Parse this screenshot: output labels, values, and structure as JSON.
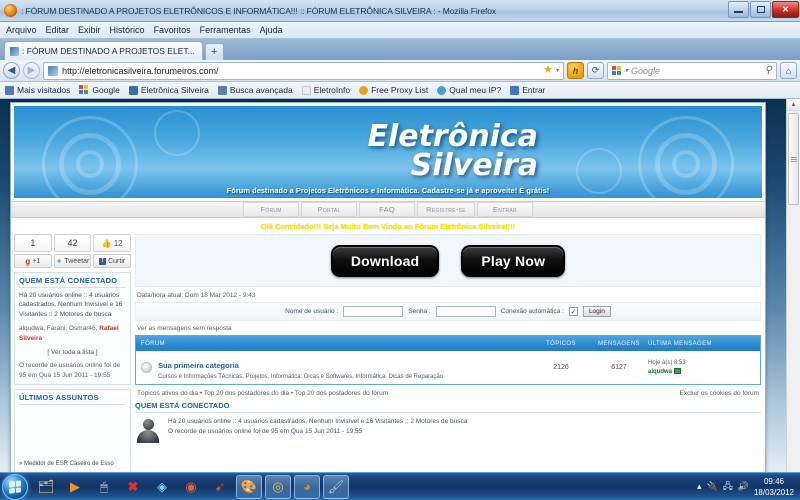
{
  "window": {
    "title": ": FÓRUM DESTINADO A PROJETOS ELETRÔNICOS E INFORMÁTICA!!! :: FÓRUM ELETRÔNICA SILVEIRA : - Mozilla Firefox",
    "app_icon": "firefox-icon",
    "minimize_label": "Minimizar",
    "maximize_label": "Restaurar",
    "close_label": "Fechar"
  },
  "menubar": {
    "items": [
      {
        "label": "Arquivo"
      },
      {
        "label": "Editar"
      },
      {
        "label": "Exibir"
      },
      {
        "label": "Histórico"
      },
      {
        "label": "Favoritos"
      },
      {
        "label": "Ferramentas"
      },
      {
        "label": "Ajuda"
      }
    ]
  },
  "tabs": {
    "items": [
      {
        "label": ": FÓRUM DESTINADO A PROJETOS ELET..."
      }
    ],
    "new_tab_label": "+"
  },
  "navbar": {
    "back_label": "◀",
    "forward_label": "▶",
    "url": "http://eletronicasilveira.forumeiros.com/",
    "star_label": "★",
    "caret_label": "▾",
    "addon_label": "h",
    "reload_label": "⟳",
    "home_label": "⌂",
    "search_placeholder": "Google",
    "search_value": "",
    "magnify_label": "⚲"
  },
  "bookmarks": {
    "items": [
      {
        "label": "Mais visitados",
        "color": "#4d79b5"
      },
      {
        "label": "Google",
        "color": "#3b77d8"
      },
      {
        "label": "Eletrônica Silveira",
        "color": "#3a6ea8"
      },
      {
        "label": "Busca avançada",
        "color": "#5a7fa8"
      },
      {
        "label": "EletroInfo",
        "color": "#e6e6e6"
      },
      {
        "label": "Free Proxy List",
        "color": "#e8a21c"
      },
      {
        "label": "Qual meu IP?",
        "color": "#4a9ed6"
      },
      {
        "label": "Entrar",
        "color": "#4472c4"
      }
    ]
  },
  "forum": {
    "banner": {
      "line1": "Eletrônica",
      "line2": "Silveira",
      "subtitle": "Fórum destinado a Projetos Eletrônicos e Informática. Cadastre-se já e aproveite! É grátis!"
    },
    "nav": [
      {
        "label": "Fórum"
      },
      {
        "label": "Portal"
      },
      {
        "label": "FAQ"
      },
      {
        "label": "Registre-se"
      },
      {
        "label": "Entrar"
      }
    ],
    "announcement": "Olá Convidado!!! Seja Muito Bem Vindo ao Fórum Eletrônica Silveira!!!!",
    "sidebar": {
      "social_counts": [
        {
          "value": "1"
        },
        {
          "value": "42"
        },
        {
          "value": "12",
          "icon": "thumbs-up-icon"
        }
      ],
      "social_buttons": [
        {
          "label": "+1",
          "icon": "google-plus-icon"
        },
        {
          "label": "Tweetar",
          "icon": "twitter-icon"
        },
        {
          "label": "Curtir",
          "icon": "facebook-icon"
        }
      ],
      "who_online": {
        "title": "QUEM ESTÁ CONECTADO",
        "summary": "Há 20 usuários online :: 4 usuários cadastrados, Nenhum Invisível e 16 Visitantes :: 2 Motores de busca",
        "count": "20",
        "users_plain": "alqudwa, Farani, Osmar46, ",
        "users_highlight": "Rafael Silveira",
        "list_link": "[ Ver toda a lista ]",
        "record": "O recorde de usuários online foi de 95 em Qua 15 Jun 2011 - 19:55",
        "record_value": "95"
      },
      "latest": {
        "title": "ÚLTIMOS ASSUNTOS",
        "items": [
          {
            "label": "» Medidor de ESR Caseiro de Esso"
          }
        ]
      }
    },
    "promo": {
      "download_label": "Download",
      "play_label": "Play Now"
    },
    "datetime": "Data/hora atual: Dom 18 Mar 2012 - 9:43",
    "login": {
      "username_label": "Nome de usuário :",
      "username_value": "",
      "password_label": "Senha :",
      "password_value": "",
      "autologin_label": "Conexão automática :",
      "autologin_checked": "✓",
      "submit_label": "Login"
    },
    "unanswered_link": "Ver as mensagens sem resposta",
    "table": {
      "headers": {
        "forum": "FÓRUM",
        "topics": "TÓPICOS",
        "messages": "MENSAGENS",
        "last_message": "ÚLTIMA MENSAGEM"
      },
      "rows": [
        {
          "name": "Sua primeira categoria",
          "description": "Cursos e Informações Técnicas, Projetos, Informática: Dicas e Softwares, Informática: Dicas de Reparação",
          "topics": "2126",
          "messages": "6127",
          "last_time": "Hoje à(s) 8:53",
          "last_author": "alqudwa"
        }
      ]
    },
    "footer_links": {
      "left": "Tópicos ativos do dia • Top 20 dos postadores do dia • Top 20 dos postadores do fórum",
      "right": "Excluir os cookies do fórum"
    },
    "who_online_main": {
      "title": "QUEM ESTÁ CONECTADO",
      "line1": "Há 20 usuários online :: 4 usuários cadastrados, Nenhum Invisível e 16 Visitantes :: 2 Motores de busca",
      "line1_count": "20",
      "line2": "O recorde de usuários online foi de 95 em Qua 15 Jun 2011 - 19:55",
      "line2_count": "95"
    }
  },
  "taskbar": {
    "start_label": "Iniciar",
    "apps": [
      {
        "name": "explorer-folder-icon",
        "glyph": "🗂",
        "active": false
      },
      {
        "name": "media-player-icon",
        "glyph": "▶",
        "active": false
      },
      {
        "name": "mouse-utility-icon",
        "glyph": "🖱",
        "active": false
      },
      {
        "name": "x-app-icon",
        "glyph": "✖",
        "active": false
      },
      {
        "name": "diamond-app-icon",
        "glyph": "◈",
        "active": false
      },
      {
        "name": "flame-app-icon",
        "glyph": "◉",
        "active": false
      },
      {
        "name": "rocket-app-icon",
        "glyph": "➹",
        "active": false
      },
      {
        "name": "paint-tools-icon",
        "glyph": "🎨",
        "active": true
      },
      {
        "name": "chrome-icon",
        "glyph": "◎",
        "active": true
      },
      {
        "name": "firefox-icon",
        "glyph": "◕",
        "active": true
      },
      {
        "name": "paint-icon",
        "glyph": "🖌",
        "active": true
      }
    ],
    "tray": [
      {
        "name": "show-hidden-icons",
        "glyph": "▴"
      },
      {
        "name": "usb-device-icon",
        "glyph": "🔌"
      },
      {
        "name": "network-icon",
        "glyph": "🖧"
      },
      {
        "name": "volume-icon",
        "glyph": "🔊"
      }
    ],
    "clock_time": "09:46",
    "clock_date": "18/03/2012"
  }
}
